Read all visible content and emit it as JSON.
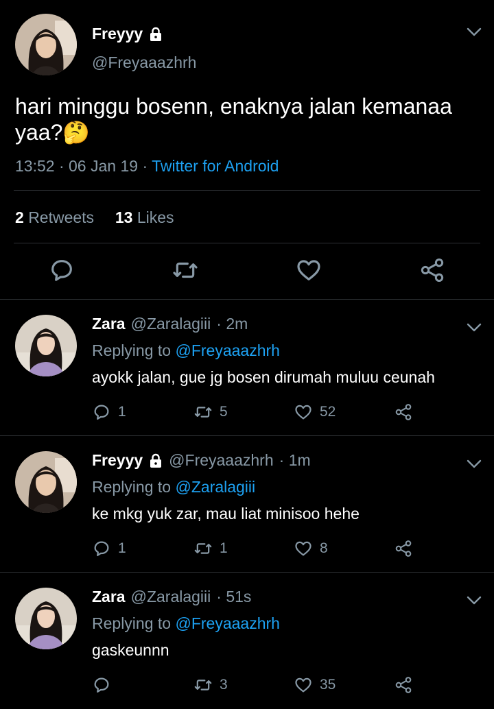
{
  "main_tweet": {
    "name": "Freyyy",
    "handle": "@Freyaaazhrh",
    "text": "hari minggu bosenn, enaknya jalan kemanaa yaa?🤔",
    "time": "13:52",
    "sep": "·",
    "date": "06 Jan 19",
    "source": "Twitter for Android",
    "retweets_count": "2",
    "retweets_label": "Retweets",
    "likes_count": "13",
    "likes_label": "Likes"
  },
  "replies": [
    {
      "name": "Zara",
      "handle": "@Zaralagiii",
      "time": "· 2m",
      "replying_prefix": "Replying to",
      "replying_to": "@Freyaaazhrh",
      "text": "ayokk jalan, gue jg bosen dirumah muluu ceunah",
      "reply_count": "1",
      "retweet_count": "5",
      "like_count": "52",
      "locked": false
    },
    {
      "name": "Freyyy",
      "handle": "@Freyaaazhrh",
      "time": "· 1m",
      "replying_prefix": "Replying to",
      "replying_to": "@Zaralagiii",
      "text": "ke mkg yuk zar, mau liat minisoo hehe",
      "reply_count": "1",
      "retweet_count": "1",
      "like_count": "8",
      "locked": true
    },
    {
      "name": "Zara",
      "handle": "@Zaralagiii",
      "time": "· 51s",
      "replying_prefix": "Replying to",
      "replying_to": "@Freyaaazhrh",
      "text": "gaskeunnn",
      "reply_count": "",
      "retweet_count": "3",
      "like_count": "35",
      "locked": false
    }
  ],
  "icons": {
    "reply": "reply-icon",
    "retweet": "retweet-icon",
    "like": "heart-icon",
    "share": "share-icon",
    "lock": "lock-icon",
    "menu": "chevron-down-icon"
  },
  "colors": {
    "background": "#000000",
    "text": "#ffffff",
    "muted": "#8899a6",
    "link": "#1da1f2",
    "divider": "#2f3336"
  }
}
